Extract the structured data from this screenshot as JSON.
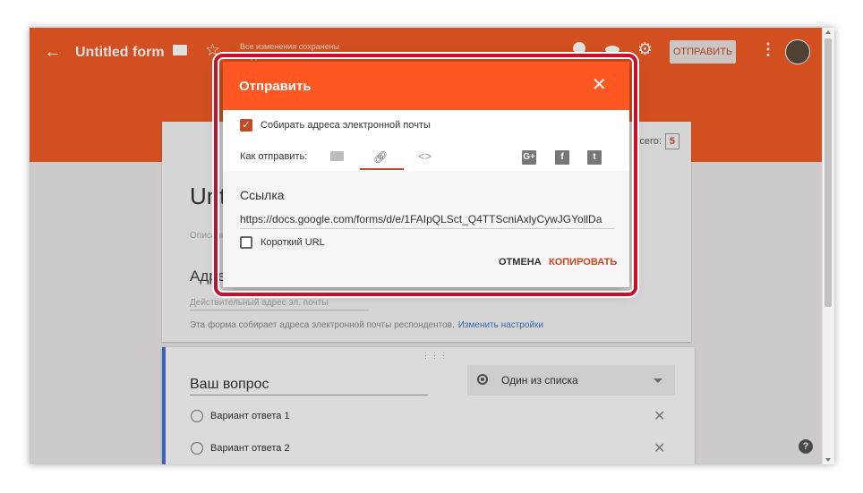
{
  "toolbar": {
    "title": "Untitled form",
    "saved_status": "Все изменения сохранены на Диске",
    "send_label": "ОТПРАВИТЬ"
  },
  "form": {
    "title": "Untitled form",
    "description_placeholder": "Описание",
    "total_label": "Всего:",
    "total_value": "5",
    "email_question": "Адрес эл. почты",
    "email_placeholder": "Действительный адрес эл. почты",
    "email_notice": "Эта форма собирает адреса электронной почты респондентов.",
    "change_settings": "Изменить настройки"
  },
  "question": {
    "title": "Ваш вопрос",
    "type": "Один из списка",
    "options": [
      "Вариант ответа 1",
      "Вариант ответа 2"
    ]
  },
  "dialog": {
    "title": "Отправить",
    "collect_emails_label": "Собирать адреса электронной почты",
    "collect_emails_checked": true,
    "how_to_send": "Как отправить:",
    "selected_method": "link",
    "social": [
      "G+",
      "f",
      "t"
    ],
    "link_title": "Ссылка",
    "link_url": "https://docs.google.com/forms/d/e/1FAIpQLSct_Q4TTScniAxlyCywJGYollDa",
    "short_url_label": "Короткий URL",
    "short_url_checked": false,
    "cancel_label": "ОТМЕНА",
    "copy_label": "КОПИРОВАТЬ"
  },
  "colors": {
    "accent": "#f05a24",
    "dialog_header": "#ff5722",
    "action": "#c24a26",
    "highlight": "#c8102e"
  }
}
